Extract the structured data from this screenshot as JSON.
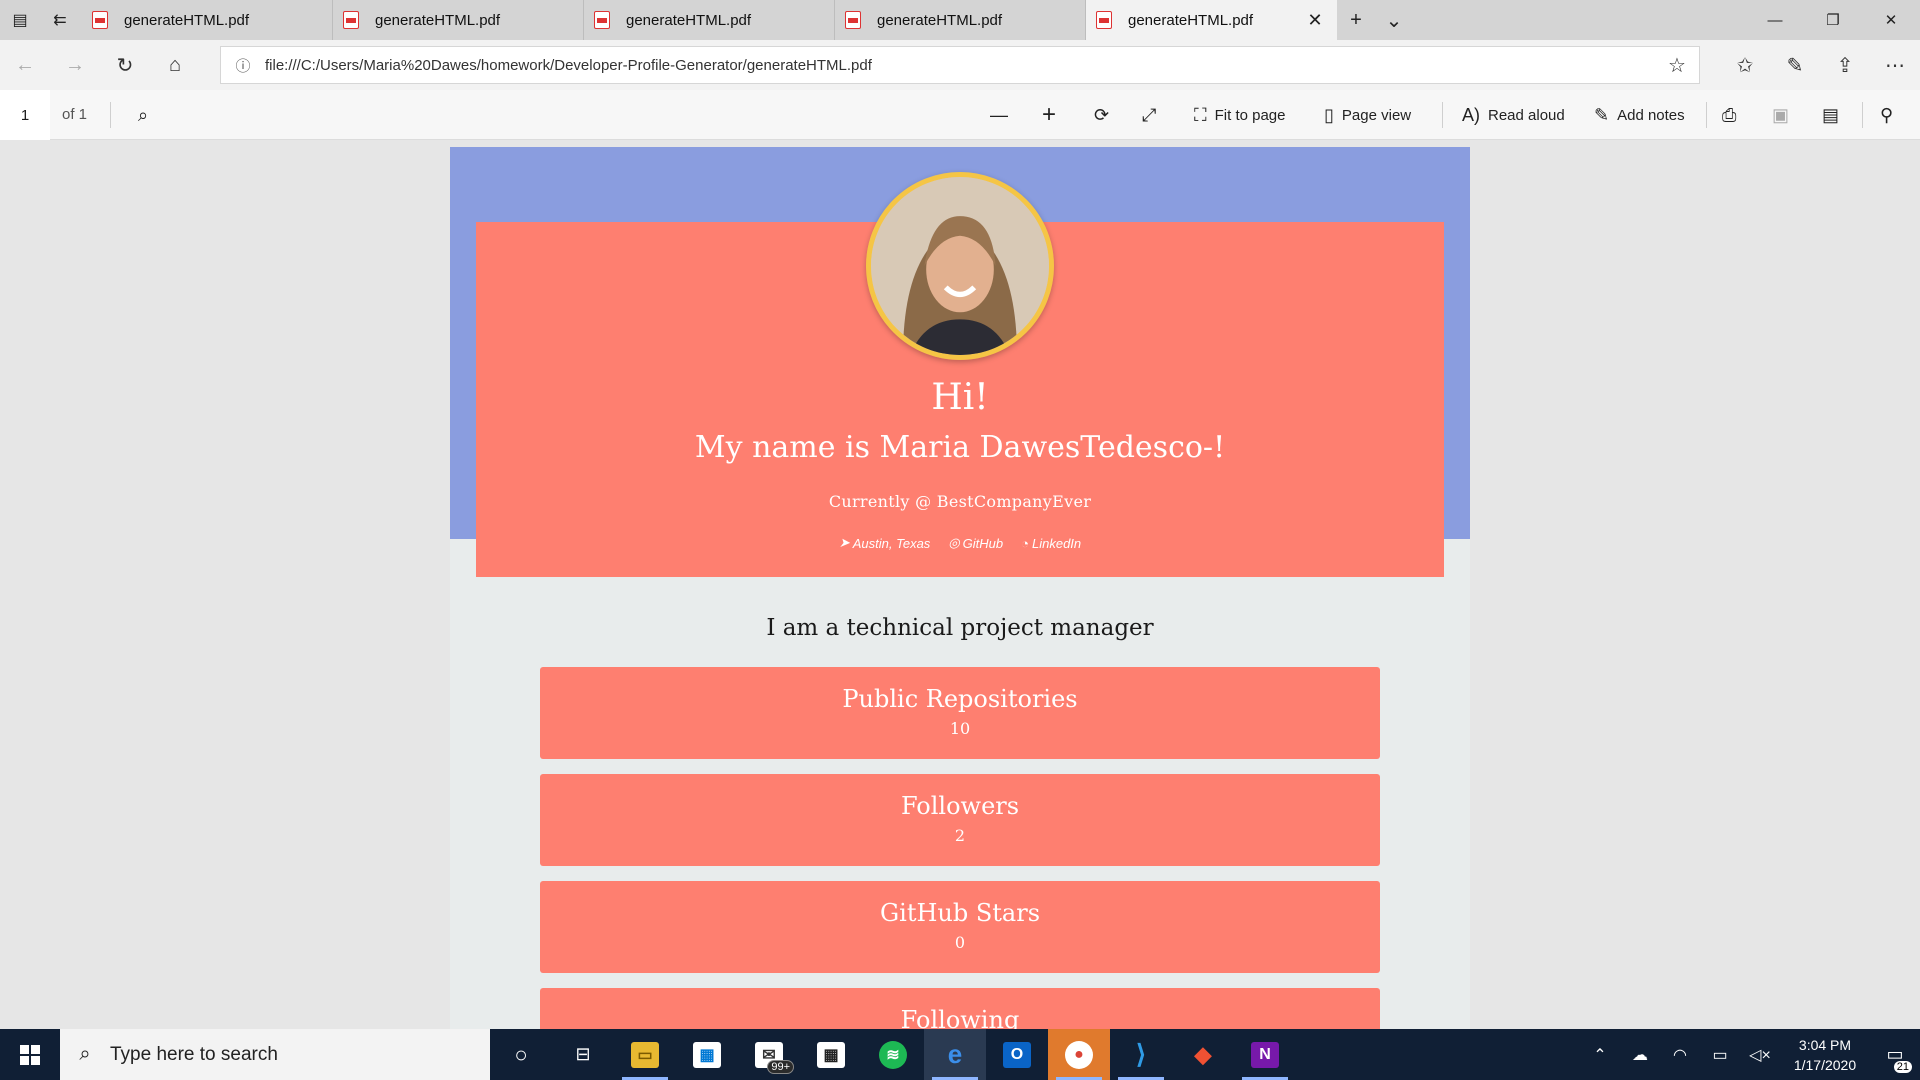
{
  "browser": {
    "tabs": [
      {
        "title": "generateHTML.pdf",
        "active": false
      },
      {
        "title": "generateHTML.pdf",
        "active": false
      },
      {
        "title": "generateHTML.pdf",
        "active": false
      },
      {
        "title": "generateHTML.pdf",
        "active": false
      },
      {
        "title": "generateHTML.pdf",
        "active": true
      }
    ],
    "address": "file:///C:/Users/Maria%20Dawes/homework/Developer-Profile-Generator/generateHTML.pdf"
  },
  "pdf_toolbar": {
    "page_number": "1",
    "page_count": "of 1",
    "fit_to_page": "Fit to page",
    "page_view": "Page view",
    "read_aloud": "Read aloud",
    "add_notes": "Add notes"
  },
  "profile": {
    "greeting": "Hi!",
    "name_line": "My name is Maria DawesTedesco-!",
    "company": "Currently @ BestCompanyEver",
    "links": {
      "location": "Austin, Texas",
      "github": "GitHub",
      "linkedin": "LinkedIn"
    },
    "bio": "I am a technical project manager",
    "stats": [
      {
        "label": "Public Repositories",
        "value": "10"
      },
      {
        "label": "Followers",
        "value": "2"
      },
      {
        "label": "GitHub Stars",
        "value": "0"
      },
      {
        "label": "Following",
        "value": ""
      }
    ],
    "colors": {
      "header_bg": "#8a9ddf",
      "card_bg": "#fe7f70",
      "avatar_border": "#f5c545",
      "page_bg": "#e8ecec"
    }
  },
  "taskbar": {
    "search_placeholder": "Type here to search",
    "mail_badge": "99+",
    "time": "3:04 PM",
    "date": "1/17/2020",
    "notification_count": "21"
  }
}
